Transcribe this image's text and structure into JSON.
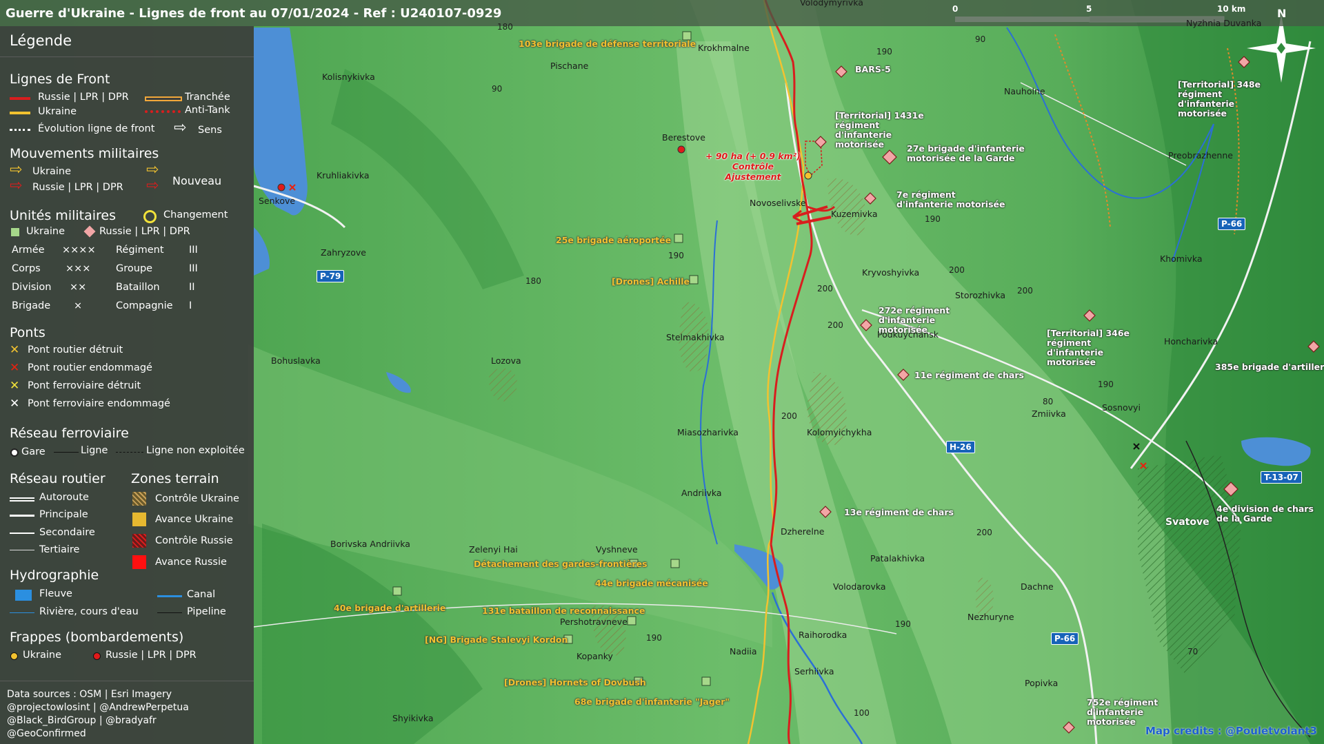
{
  "title": "Guerre d'Ukraine - Lignes de front au 07/01/2024 - Ref : U240107-0929",
  "scale": {
    "labels": [
      "0",
      "5",
      "10 km"
    ],
    "north": "N"
  },
  "legend": {
    "title": "Légende",
    "front": {
      "heading": "Lignes de Front",
      "russia": "Russie | LPR | DPR",
      "ukraine": "Ukraine",
      "evolution": "Évolution ligne de front",
      "trench": "Tranchée",
      "antitank": "Anti-Tank",
      "direction": "Sens"
    },
    "moves": {
      "heading": "Mouvements militaires",
      "ukraine": "Ukraine",
      "russia": "Russie | LPR | DPR",
      "new": "Nouveau"
    },
    "units": {
      "heading": "Unités militaires",
      "change": "Changement",
      "ukraine": "Ukraine",
      "russia": "Russie | LPR | DPR",
      "rows": [
        {
          "a": "Armée",
          "as": "××××",
          "b": "Régiment",
          "bs": "III"
        },
        {
          "a": "Corps",
          "as": "×××",
          "b": "Groupe",
          "bs": "III"
        },
        {
          "a": "Division",
          "as": "××",
          "b": "Bataillon",
          "bs": "II"
        },
        {
          "a": "Brigade",
          "as": "×",
          "b": "Compagnie",
          "bs": "I"
        }
      ]
    },
    "bridges": {
      "heading": "Ponts",
      "items": [
        "Pont routier détruit",
        "Pont routier endommagé",
        "Pont ferroviaire détruit",
        "Pont ferroviaire endommagé"
      ]
    },
    "rail": {
      "heading": "Réseau ferroviaire",
      "station": "Gare",
      "line": "Ligne",
      "unused": "Ligne non exploitée"
    },
    "roads": {
      "heading": "Réseau routier",
      "items": [
        "Autoroute",
        "Principale",
        "Secondaire",
        "Tertiaire"
      ]
    },
    "zones": {
      "heading": "Zones terrain",
      "items": [
        "Contrôle Ukraine",
        "Avance Ukraine",
        "Contrôle Russie",
        "Avance Russie"
      ]
    },
    "hydro": {
      "heading": "Hydrographie",
      "river": "Fleuve",
      "canal": "Canal",
      "stream": "Rivière, cours d'eau",
      "pipeline": "Pipeline"
    },
    "strikes": {
      "heading": "Frappes (bombardements)",
      "ukraine": "Ukraine",
      "russia": "Russie | LPR | DPR"
    },
    "sources": [
      "Data sources : OSM | Esri Imagery",
      "@projectowlosint | @AndrewPerpetua",
      "@Black_BirdGroup | @bradyafr",
      "@GeoConfirmed"
    ]
  },
  "colors": {
    "russia": "#d81e1e",
    "ukraine": "#f2c230",
    "water": "#4d8fd6",
    "legend_bg": "#3c3e3c"
  },
  "places": [
    "Volodymyrivka",
    "Krokhmalne",
    "Pischane",
    "Kolisnykivka",
    "Berestove",
    "Kruhliakivka",
    "Senkove",
    "Zahryzove",
    "Novoselivske",
    "Kuzemivka",
    "Kryvoshyivka",
    "Storozhivka",
    "Podkuychansk",
    "Stelmakhivka",
    "Lozova",
    "Bohuslavka",
    "Miasozharivka",
    "Kolomyichykha",
    "Andriivka",
    "Dzherelne",
    "Patalakhivka",
    "Volodarovka",
    "Raihorodka",
    "Nadiia",
    "Serhiivka",
    "Kopanky",
    "Pershotravneve",
    "Vyshneve",
    "Zelenyi Hai",
    "Borivska Andriivka",
    "Shyikivka",
    "Nauholne",
    "Preobrazhenne",
    "Khomivka",
    "Honcharivka",
    "Sosnovyi",
    "Zmiivka",
    "Svatove",
    "Dachne",
    "Nezhuryne",
    "Popivka",
    "Nyzhnia Duvanka"
  ],
  "roads": [
    "P-79",
    "P-66",
    "H-26",
    "T-13-07",
    "P-66"
  ],
  "elevations": [
    "180",
    "190",
    "90",
    "190",
    "90",
    "190",
    "180",
    "200",
    "200",
    "200",
    "200",
    "190",
    "200",
    "200",
    "180",
    "80",
    "190",
    "190",
    "100",
    "70"
  ],
  "ukraine_units": [
    "103e brigade de défense territoriale",
    "25e brigade aéroportée",
    "[Drones] Achille",
    "Détachement des gardes-frontières",
    "44e brigade mécanisée",
    "40e brigade d'artillerie",
    "131e bataillon de reconnaissance",
    "[NG] Brigade Stalevyi Kordon",
    "[Drones] Hornets of Dovbush",
    "68e brigade d'infanterie \"Jager\""
  ],
  "russia_units": [
    "BARS-5",
    "[Territorial] 1431e régiment d'infanterie motorisée",
    "27e brigade d'infanterie motorisée de la Garde",
    "7e régiment d'infanterie motorisée",
    "272e régiment d'infanterie motorisée",
    "11e régiment de chars",
    "13e régiment de chars",
    "[Territorial] 346e régiment d'infanterie motorisée",
    "385e brigade d'artillerie",
    "[Territorial] 348e régiment d'infanterie motorisée",
    "4e division de chars de la Garde",
    "752e régiment d'infanterie motorisée"
  ],
  "annotation": [
    "+ 90 ha (+ 0.9 km²)",
    "Contrôle",
    "Ajustement"
  ],
  "credits": "Map credits : @Pouletvolant3"
}
